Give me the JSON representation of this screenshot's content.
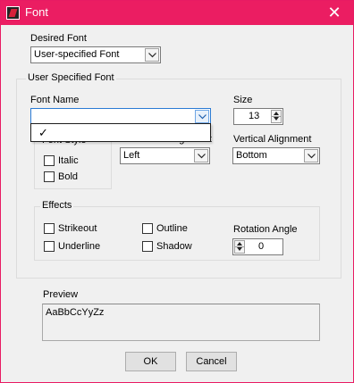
{
  "window": {
    "title": "Font",
    "close_symbol": "✕"
  },
  "desired_font": {
    "label": "Desired Font",
    "value": "User-specified Font"
  },
  "user_font": {
    "group_title": "User Specified Font",
    "font_name": {
      "label": "Font Name",
      "value": "",
      "dropdown_item": "✓"
    },
    "size": {
      "label": "Size",
      "value": "13"
    },
    "font_style": {
      "group_title": "Font Style",
      "italic": "Italic",
      "bold": "Bold"
    },
    "horizontal_alignment": {
      "label": "Horizontal Alignment",
      "value": "Left"
    },
    "vertical_alignment": {
      "label": "Vertical Alignment",
      "value": "Bottom"
    },
    "effects": {
      "group_title": "Effects",
      "strikeout": "Strikeout",
      "underline": "Underline",
      "outline": "Outline",
      "shadow": "Shadow",
      "rotation_label": "Rotation Angle",
      "rotation_value": "0"
    }
  },
  "preview": {
    "label": "Preview",
    "sample": "AaBbCcYyZz"
  },
  "buttons": {
    "ok": "OK",
    "cancel": "Cancel"
  },
  "colors": {
    "titlebar": "#eb1d62",
    "dialog_bg": "#f0f0f0"
  },
  "icons": [
    "app-icon",
    "close-icon",
    "chevron-down-icon",
    "spin-up-icon",
    "spin-down-icon",
    "checkmark-icon"
  ]
}
